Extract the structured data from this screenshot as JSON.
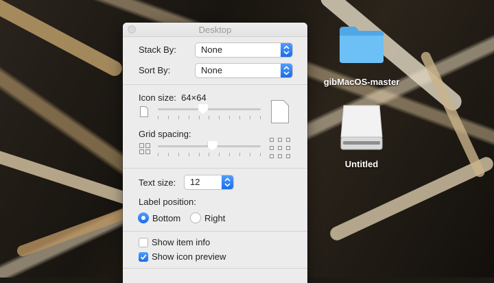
{
  "window": {
    "title": "Desktop"
  },
  "stack_by": {
    "label": "Stack By:",
    "value": "None"
  },
  "sort_by": {
    "label": "Sort By:",
    "value": "None"
  },
  "icon_size": {
    "label": "Icon size:",
    "value": "64×64",
    "level": 0.44
  },
  "grid_spacing": {
    "label": "Grid spacing:",
    "level": 0.53
  },
  "text_size": {
    "label": "Text size:",
    "value": "12"
  },
  "label_position": {
    "label": "Label position:",
    "options": [
      {
        "label": "Bottom",
        "selected": true
      },
      {
        "label": "Right",
        "selected": false
      }
    ]
  },
  "options": [
    {
      "label": "Show item info",
      "checked": false
    },
    {
      "label": "Show icon preview",
      "checked": true
    }
  ],
  "desktop_items": [
    {
      "label": "gibMacOS-master",
      "icon": "folder-icon"
    },
    {
      "label": "Untitled",
      "icon": "drive-icon"
    }
  ],
  "colors": {
    "accent": "#1f6fe9",
    "folder": "#5ab4f0"
  }
}
